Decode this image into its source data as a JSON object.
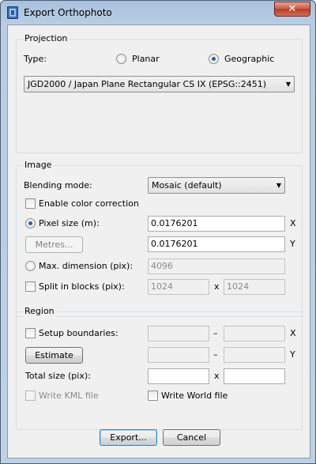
{
  "window": {
    "title": "Export Orthophoto",
    "close_glyph": "✕"
  },
  "projection": {
    "group_title": "Projection",
    "type_label": "Type:",
    "planar_label": "Planar",
    "geographic_label": "Geographic",
    "selected_type": "Geographic",
    "crs_value": "JGD2000 / Japan Plane Rectangular CS IX (EPSG::2451)"
  },
  "image": {
    "group_title": "Image",
    "blending_label": "Blending mode:",
    "blending_value": "Mosaic (default)",
    "color_correction_label": "Enable color correction",
    "color_correction_checked": false,
    "pixel_size_label": "Pixel size (m):",
    "pixel_size_selected": true,
    "pixel_x": "0.0176201",
    "pixel_y": "0.0176201",
    "x_axis": "X",
    "y_axis": "Y",
    "metres_button": "Metres...",
    "max_dim_label": "Max. dimension (pix):",
    "max_dim_value": "4096",
    "split_label": "Split in blocks (pix):",
    "split_checked": false,
    "split_w": "1024",
    "split_h": "1024",
    "times_sign": "x"
  },
  "region": {
    "group_title": "Region",
    "setup_label": "Setup boundaries:",
    "setup_checked": false,
    "x_min": "",
    "x_max": "",
    "y_min": "",
    "y_max": "",
    "dash": "–",
    "x_axis": "X",
    "y_axis": "Y",
    "estimate_button": "Estimate",
    "total_size_label": "Total size (pix):",
    "total_w": "",
    "total_h": "",
    "times_sign": "x",
    "kml_label": "Write KML file",
    "kml_checked": false,
    "world_label": "Write World file",
    "world_checked": false
  },
  "buttons": {
    "export": "Export...",
    "cancel": "Cancel"
  }
}
